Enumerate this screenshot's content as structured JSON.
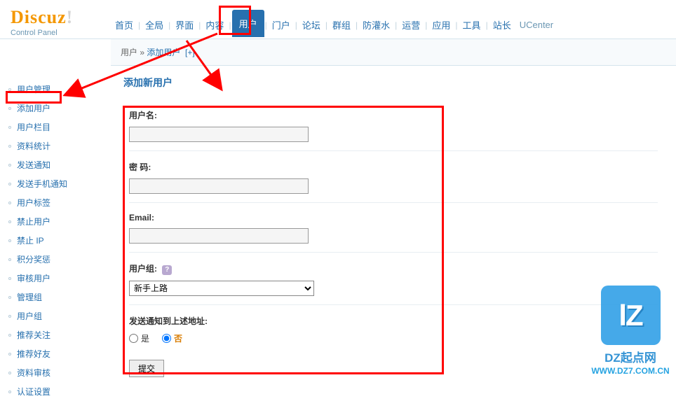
{
  "logo": {
    "main": "Discuz",
    "punct": "!",
    "sub": "Control Panel"
  },
  "topnav": {
    "items": [
      "首页",
      "全局",
      "界面",
      "内容",
      "用户",
      "门户",
      "论坛",
      "群组",
      "防灌水",
      "运营",
      "应用",
      "工具",
      "站长"
    ],
    "active_index": 4,
    "ucenter": "UCenter"
  },
  "breadcrumb": {
    "root": "用户",
    "sep": " » ",
    "current": "添加用户",
    "plus": "[+]"
  },
  "sidebar": {
    "items": [
      "用户管理",
      "添加用户",
      "用户栏目",
      "资料统计",
      "发送通知",
      "发送手机通知",
      "用户标签",
      "禁止用户",
      "禁止 IP",
      "积分奖惩",
      "审核用户",
      "管理组",
      "用户组",
      "推荐关注",
      "推荐好友",
      "资料审核",
      "认证设置"
    ]
  },
  "section_title": "添加新用户",
  "form": {
    "username_label": "用户名:",
    "username_value": "",
    "password_label": "密  码:",
    "password_value": "",
    "email_label": "Email:",
    "email_value": "",
    "group_label": "用户组:",
    "group_help": "?",
    "group_selected": "新手上路",
    "notify_label": "发送通知到上述地址:",
    "notify_yes": "是",
    "notify_no": "否",
    "notify_value": "no",
    "submit": "提交"
  },
  "watermark": {
    "lz": "lZ",
    "text": "DZ起点网",
    "url": "WWW.DZ7.COM.CN"
  }
}
